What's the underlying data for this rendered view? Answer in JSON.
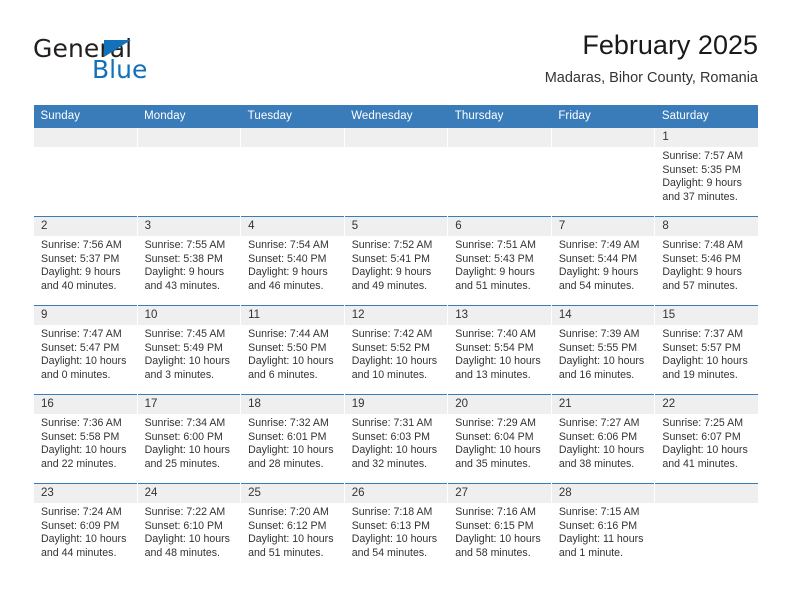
{
  "brand": {
    "name_part1": "General",
    "name_part2": "Blue",
    "triangle_color": "#1271b8"
  },
  "header": {
    "title": "February 2025",
    "subtitle": "Madaras, Bihor County, Romania"
  },
  "theme": {
    "header_blue": "#3a7cba",
    "daynum_band": "#efefef",
    "text": "#333333"
  },
  "weekdays": [
    "Sunday",
    "Monday",
    "Tuesday",
    "Wednesday",
    "Thursday",
    "Friday",
    "Saturday"
  ],
  "weeks": [
    [
      {
        "day": "",
        "blank": true
      },
      {
        "day": "",
        "blank": true
      },
      {
        "day": "",
        "blank": true
      },
      {
        "day": "",
        "blank": true
      },
      {
        "day": "",
        "blank": true
      },
      {
        "day": "",
        "blank": true
      },
      {
        "day": "1",
        "sunrise": "Sunrise: 7:57 AM",
        "sunset": "Sunset: 5:35 PM",
        "daylight": "Daylight: 9 hours and 37 minutes."
      }
    ],
    [
      {
        "day": "2",
        "sunrise": "Sunrise: 7:56 AM",
        "sunset": "Sunset: 5:37 PM",
        "daylight": "Daylight: 9 hours and 40 minutes."
      },
      {
        "day": "3",
        "sunrise": "Sunrise: 7:55 AM",
        "sunset": "Sunset: 5:38 PM",
        "daylight": "Daylight: 9 hours and 43 minutes."
      },
      {
        "day": "4",
        "sunrise": "Sunrise: 7:54 AM",
        "sunset": "Sunset: 5:40 PM",
        "daylight": "Daylight: 9 hours and 46 minutes."
      },
      {
        "day": "5",
        "sunrise": "Sunrise: 7:52 AM",
        "sunset": "Sunset: 5:41 PM",
        "daylight": "Daylight: 9 hours and 49 minutes."
      },
      {
        "day": "6",
        "sunrise": "Sunrise: 7:51 AM",
        "sunset": "Sunset: 5:43 PM",
        "daylight": "Daylight: 9 hours and 51 minutes."
      },
      {
        "day": "7",
        "sunrise": "Sunrise: 7:49 AM",
        "sunset": "Sunset: 5:44 PM",
        "daylight": "Daylight: 9 hours and 54 minutes."
      },
      {
        "day": "8",
        "sunrise": "Sunrise: 7:48 AM",
        "sunset": "Sunset: 5:46 PM",
        "daylight": "Daylight: 9 hours and 57 minutes."
      }
    ],
    [
      {
        "day": "9",
        "sunrise": "Sunrise: 7:47 AM",
        "sunset": "Sunset: 5:47 PM",
        "daylight": "Daylight: 10 hours and 0 minutes."
      },
      {
        "day": "10",
        "sunrise": "Sunrise: 7:45 AM",
        "sunset": "Sunset: 5:49 PM",
        "daylight": "Daylight: 10 hours and 3 minutes."
      },
      {
        "day": "11",
        "sunrise": "Sunrise: 7:44 AM",
        "sunset": "Sunset: 5:50 PM",
        "daylight": "Daylight: 10 hours and 6 minutes."
      },
      {
        "day": "12",
        "sunrise": "Sunrise: 7:42 AM",
        "sunset": "Sunset: 5:52 PM",
        "daylight": "Daylight: 10 hours and 10 minutes."
      },
      {
        "day": "13",
        "sunrise": "Sunrise: 7:40 AM",
        "sunset": "Sunset: 5:54 PM",
        "daylight": "Daylight: 10 hours and 13 minutes."
      },
      {
        "day": "14",
        "sunrise": "Sunrise: 7:39 AM",
        "sunset": "Sunset: 5:55 PM",
        "daylight": "Daylight: 10 hours and 16 minutes."
      },
      {
        "day": "15",
        "sunrise": "Sunrise: 7:37 AM",
        "sunset": "Sunset: 5:57 PM",
        "daylight": "Daylight: 10 hours and 19 minutes."
      }
    ],
    [
      {
        "day": "16",
        "sunrise": "Sunrise: 7:36 AM",
        "sunset": "Sunset: 5:58 PM",
        "daylight": "Daylight: 10 hours and 22 minutes."
      },
      {
        "day": "17",
        "sunrise": "Sunrise: 7:34 AM",
        "sunset": "Sunset: 6:00 PM",
        "daylight": "Daylight: 10 hours and 25 minutes."
      },
      {
        "day": "18",
        "sunrise": "Sunrise: 7:32 AM",
        "sunset": "Sunset: 6:01 PM",
        "daylight": "Daylight: 10 hours and 28 minutes."
      },
      {
        "day": "19",
        "sunrise": "Sunrise: 7:31 AM",
        "sunset": "Sunset: 6:03 PM",
        "daylight": "Daylight: 10 hours and 32 minutes."
      },
      {
        "day": "20",
        "sunrise": "Sunrise: 7:29 AM",
        "sunset": "Sunset: 6:04 PM",
        "daylight": "Daylight: 10 hours and 35 minutes."
      },
      {
        "day": "21",
        "sunrise": "Sunrise: 7:27 AM",
        "sunset": "Sunset: 6:06 PM",
        "daylight": "Daylight: 10 hours and 38 minutes."
      },
      {
        "day": "22",
        "sunrise": "Sunrise: 7:25 AM",
        "sunset": "Sunset: 6:07 PM",
        "daylight": "Daylight: 10 hours and 41 minutes."
      }
    ],
    [
      {
        "day": "23",
        "sunrise": "Sunrise: 7:24 AM",
        "sunset": "Sunset: 6:09 PM",
        "daylight": "Daylight: 10 hours and 44 minutes."
      },
      {
        "day": "24",
        "sunrise": "Sunrise: 7:22 AM",
        "sunset": "Sunset: 6:10 PM",
        "daylight": "Daylight: 10 hours and 48 minutes."
      },
      {
        "day": "25",
        "sunrise": "Sunrise: 7:20 AM",
        "sunset": "Sunset: 6:12 PM",
        "daylight": "Daylight: 10 hours and 51 minutes."
      },
      {
        "day": "26",
        "sunrise": "Sunrise: 7:18 AM",
        "sunset": "Sunset: 6:13 PM",
        "daylight": "Daylight: 10 hours and 54 minutes."
      },
      {
        "day": "27",
        "sunrise": "Sunrise: 7:16 AM",
        "sunset": "Sunset: 6:15 PM",
        "daylight": "Daylight: 10 hours and 58 minutes."
      },
      {
        "day": "28",
        "sunrise": "Sunrise: 7:15 AM",
        "sunset": "Sunset: 6:16 PM",
        "daylight": "Daylight: 11 hours and 1 minute."
      },
      {
        "day": "",
        "blank": true
      }
    ]
  ]
}
